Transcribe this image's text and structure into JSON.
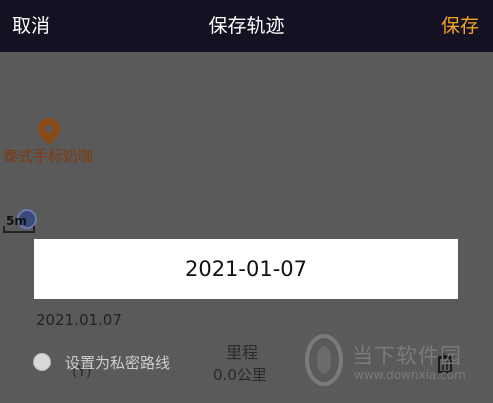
{
  "header": {
    "cancel_label": "取消",
    "title": "保存轨迹",
    "save_label": "保存"
  },
  "map": {
    "poi_label": "泰式手标奶咖",
    "scale_label": "5m"
  },
  "date_dialog": {
    "date": "2021-01-07"
  },
  "track": {
    "date": "2021.01.07",
    "sub": "(Y)",
    "private_label": "设置为私密路线",
    "mileage_title": "里程",
    "mileage_value": "0.0公里"
  },
  "watermark": {
    "title": "当下软件园",
    "url": "www.downxia.com"
  },
  "colors": {
    "header_bg": "#131122",
    "save_accent": "#f5a623",
    "dim_overlay": "#5b5b5b"
  }
}
